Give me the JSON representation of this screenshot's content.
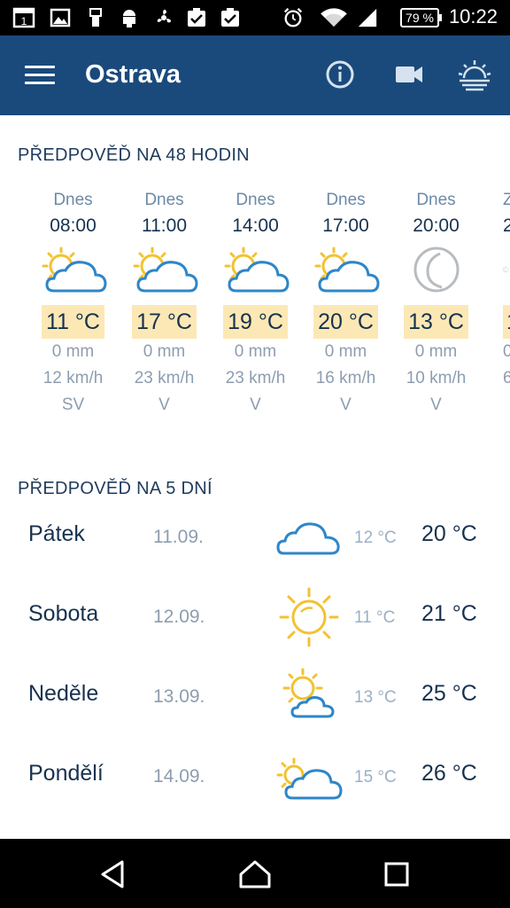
{
  "status_bar": {
    "time": "10:22",
    "battery": "79 %",
    "calendar_day": "1",
    "icons": [
      "calendar-icon",
      "image-icon",
      "usb-icon",
      "android-debug-icon",
      "fan-icon",
      "task-done-icon",
      "task-done-icon",
      "alarm-icon",
      "wifi-icon",
      "signal-icon",
      "battery-icon"
    ]
  },
  "app_bar": {
    "title": "Ostrava",
    "actions": [
      "info-icon",
      "video-camera-icon",
      "sunrise-icon"
    ],
    "color": "#1a4a7c"
  },
  "forecast48": {
    "title": "PŘEDPOVĚĎ NA 48 HODIN",
    "hours": [
      {
        "day": "Dnes",
        "time": "08:00",
        "icon": "sun-cloud-icon",
        "temp": "11 °C",
        "rain": "0 mm",
        "wind": "12 km/h",
        "dir": "SV"
      },
      {
        "day": "Dnes",
        "time": "11:00",
        "icon": "sun-cloud-icon",
        "temp": "17 °C",
        "rain": "0 mm",
        "wind": "23 km/h",
        "dir": "V"
      },
      {
        "day": "Dnes",
        "time": "14:00",
        "icon": "sun-cloud-icon",
        "temp": "19 °C",
        "rain": "0 mm",
        "wind": "23 km/h",
        "dir": "V"
      },
      {
        "day": "Dnes",
        "time": "17:00",
        "icon": "sun-cloud-icon",
        "temp": "20 °C",
        "rain": "0 mm",
        "wind": "16 km/h",
        "dir": "V"
      },
      {
        "day": "Dnes",
        "time": "20:00",
        "icon": "moon-icon",
        "temp": "13 °C",
        "rain": "0 mm",
        "wind": "10 km/h",
        "dir": "V"
      },
      {
        "day": "Z",
        "time": "2",
        "icon": "moon-icon",
        "temp": "1",
        "rain": "0",
        "wind": "6",
        "dir": ""
      }
    ]
  },
  "forecast5": {
    "title": "PŘEDPOVĚĎ NA 5 DNÍ",
    "days": [
      {
        "name": "Pátek",
        "date": "11.09.",
        "icon": "cloud-icon",
        "min": "12 °C",
        "max": "20 °C"
      },
      {
        "name": "Sobota",
        "date": "12.09.",
        "icon": "sun-icon",
        "min": "11 °C",
        "max": "21 °C"
      },
      {
        "name": "Neděle",
        "date": "13.09.",
        "icon": "sun-small-cloud-icon",
        "min": "13 °C",
        "max": "25 °C"
      },
      {
        "name": "Pondělí",
        "date": "14.09.",
        "icon": "cloud-sun-icon",
        "min": "15 °C",
        "max": "26 °C"
      }
    ]
  },
  "nav_bar": {
    "buttons": [
      "back-icon",
      "home-icon",
      "recents-icon"
    ]
  },
  "colors": {
    "sun": "#f2c230",
    "cloud": "#2e86c9",
    "moon": "#b8bcc0",
    "temp_bg": "#fce8b5"
  }
}
